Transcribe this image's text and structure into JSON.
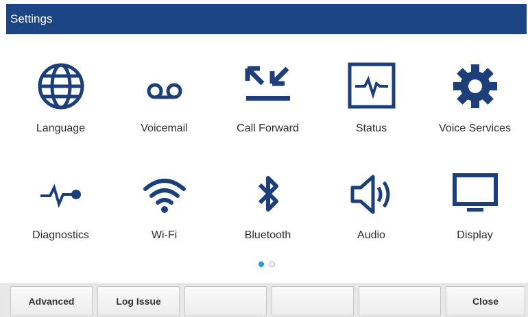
{
  "header": {
    "title": "Settings"
  },
  "tiles": [
    {
      "label": "Language",
      "icon": "globe-icon"
    },
    {
      "label": "Voicemail",
      "icon": "voicemail-icon"
    },
    {
      "label": "Call Forward",
      "icon": "call-forward-icon"
    },
    {
      "label": "Status",
      "icon": "status-icon"
    },
    {
      "label": "Voice Services",
      "icon": "gear-icon"
    },
    {
      "label": "Diagnostics",
      "icon": "diagnostics-icon"
    },
    {
      "label": "Wi-Fi",
      "icon": "wifi-icon"
    },
    {
      "label": "Bluetooth",
      "icon": "bluetooth-icon"
    },
    {
      "label": "Audio",
      "icon": "speaker-icon"
    },
    {
      "label": "Display",
      "icon": "monitor-icon"
    }
  ],
  "pager": {
    "current": 1,
    "total": 2
  },
  "softkeys": [
    "Advanced",
    "Log Issue",
    "",
    "",
    "",
    "Close"
  ],
  "colors": {
    "titlebar": "#1c4585",
    "icon": "#1c3f7a",
    "pager_active": "#1e9bd8"
  }
}
